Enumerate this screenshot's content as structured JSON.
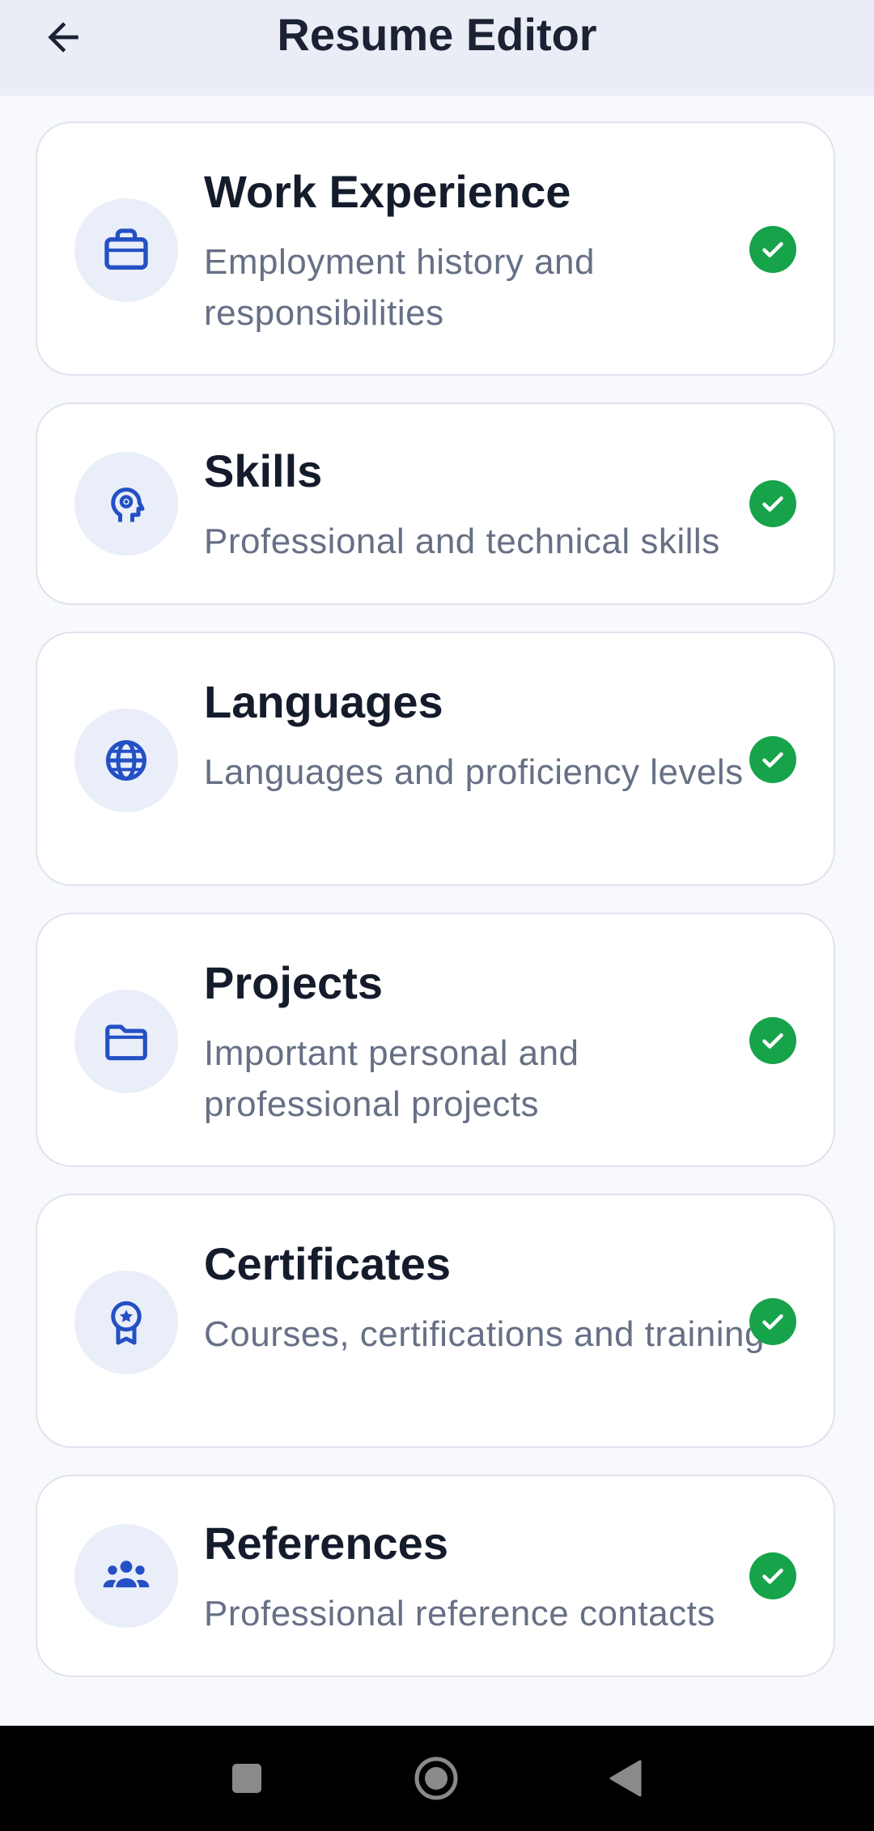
{
  "app_bar": {
    "title": "Resume Editor",
    "back_icon": "arrow-left-icon"
  },
  "colors": {
    "accent": "#2450c4",
    "icon_bg": "#e9eef9",
    "check_green": "#16a34a",
    "title_text": "#141c2c",
    "desc_text": "#667085"
  },
  "sections": [
    {
      "id": "work-experience",
      "title": "Work Experience",
      "description": "Employment history and responsibilities",
      "icon": "briefcase-icon",
      "status": "complete"
    },
    {
      "id": "skills",
      "title": "Skills",
      "description": "Professional and technical skills",
      "icon": "head-gear-icon",
      "status": "complete"
    },
    {
      "id": "languages",
      "title": "Languages",
      "description": "Languages and proficiency levels",
      "icon": "globe-icon",
      "status": "complete"
    },
    {
      "id": "projects",
      "title": "Projects",
      "description": "Important personal and professional projects",
      "icon": "folder-icon",
      "status": "complete"
    },
    {
      "id": "certificates",
      "title": "Certificates",
      "description": "Courses, certifications and training",
      "icon": "award-icon",
      "status": "complete"
    },
    {
      "id": "references",
      "title": "References",
      "description": "Professional reference contacts",
      "icon": "group-icon",
      "status": "complete"
    }
  ],
  "system_nav": {
    "recents_icon": "square-icon",
    "home_icon": "circle-home-icon",
    "back_icon": "triangle-back-icon"
  }
}
